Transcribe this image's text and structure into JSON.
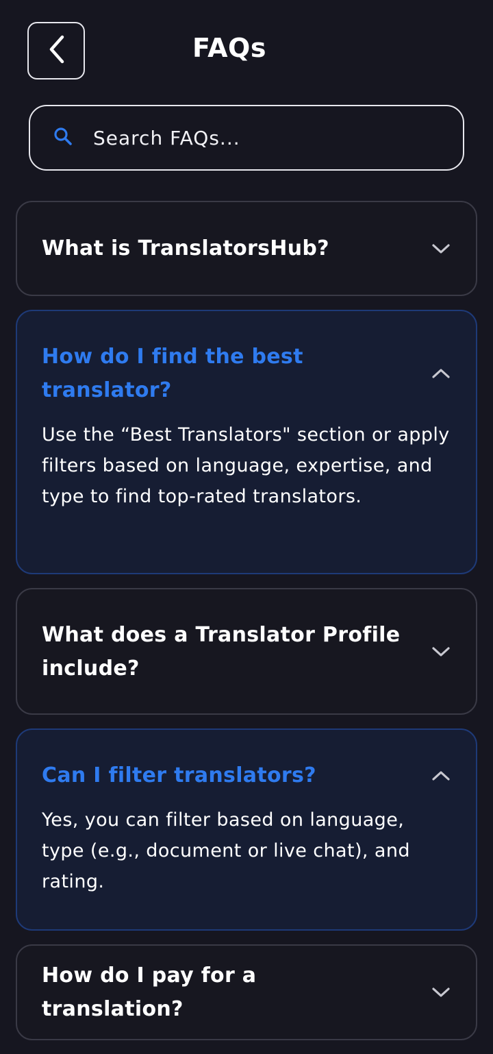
{
  "header": {
    "title": "FAQs",
    "back_icon": "chevron-left-icon"
  },
  "search": {
    "placeholder": "Search FAQs...",
    "icon": "search-icon",
    "icon_color": "#2f7bef"
  },
  "colors": {
    "background": "#161620",
    "accent": "#2f7bef",
    "open_card_bg": "#161d33"
  },
  "faqs": [
    {
      "question": "What is TranslatorsHub?",
      "expanded": false,
      "answer": ""
    },
    {
      "question": "How do I find the best translator?",
      "expanded": true,
      "answer": "Use the “Best Translators\" section or apply filters based on language, expertise, and type to find top-rated translators."
    },
    {
      "question": "What does a Translator Profile include?",
      "expanded": false,
      "answer": ""
    },
    {
      "question": "Can I filter translators?",
      "expanded": true,
      "answer": "Yes, you can filter based on language, type (e.g., document or live chat), and rating."
    },
    {
      "question": "How do I pay for a translation?",
      "expanded": false,
      "answer": ""
    }
  ]
}
